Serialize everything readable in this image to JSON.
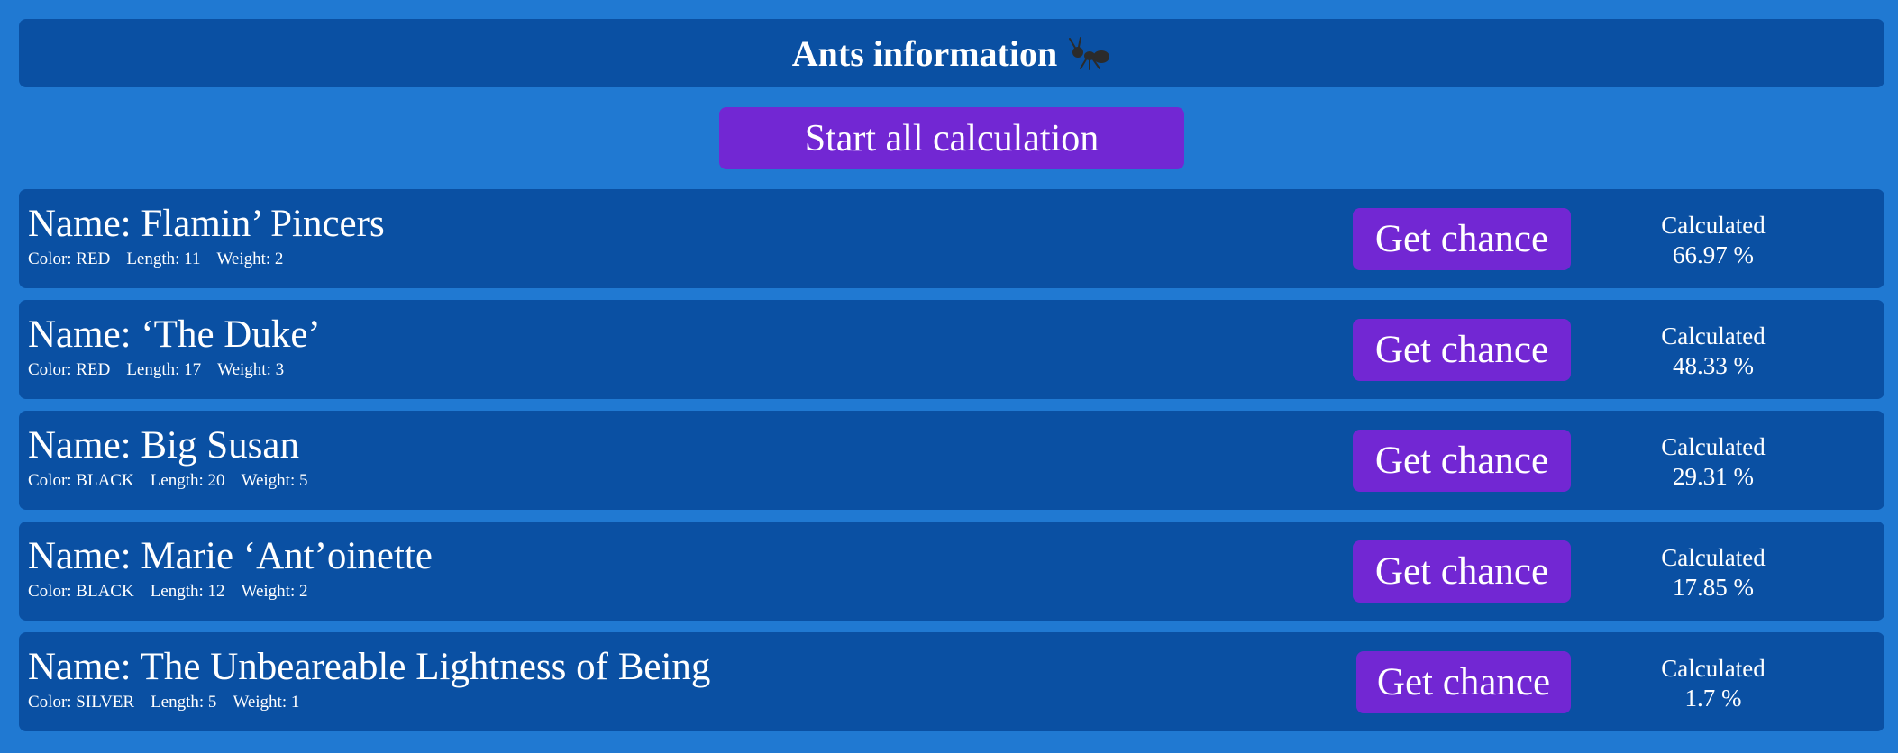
{
  "header": {
    "title": "Ants information",
    "icon": "ant-icon"
  },
  "start_button_label": "Start all calculation",
  "ants": [
    {
      "name": "Name: Flamin’ Pincers",
      "color": "Color: RED",
      "length": "Length: 11",
      "weight": "Weight: 2",
      "button_label": "Get chance",
      "status": "Calculated",
      "chance": "66.97 %"
    },
    {
      "name": "Name: ‘The Duke’",
      "color": "Color: RED",
      "length": "Length: 17",
      "weight": "Weight: 3",
      "button_label": "Get chance",
      "status": "Calculated",
      "chance": "48.33 %"
    },
    {
      "name": "Name: Big Susan",
      "color": "Color: BLACK",
      "length": "Length: 20",
      "weight": "Weight: 5",
      "button_label": "Get chance",
      "status": "Calculated",
      "chance": "29.31 %"
    },
    {
      "name": "Name: Marie ‘Ant’oinette",
      "color": "Color: BLACK",
      "length": "Length: 12",
      "weight": "Weight: 2",
      "button_label": "Get chance",
      "status": "Calculated",
      "chance": "17.85 %"
    },
    {
      "name": "Name: The Unbeareable Lightness of Being",
      "color": "Color: SILVER",
      "length": "Length: 5",
      "weight": "Weight: 1",
      "button_label": "Get chance",
      "status": "Calculated",
      "chance": "1.7 %"
    }
  ],
  "colors": {
    "background": "#2079d2",
    "panel": "#0a50a3",
    "button": "#7227d3",
    "text": "#ffffff"
  }
}
